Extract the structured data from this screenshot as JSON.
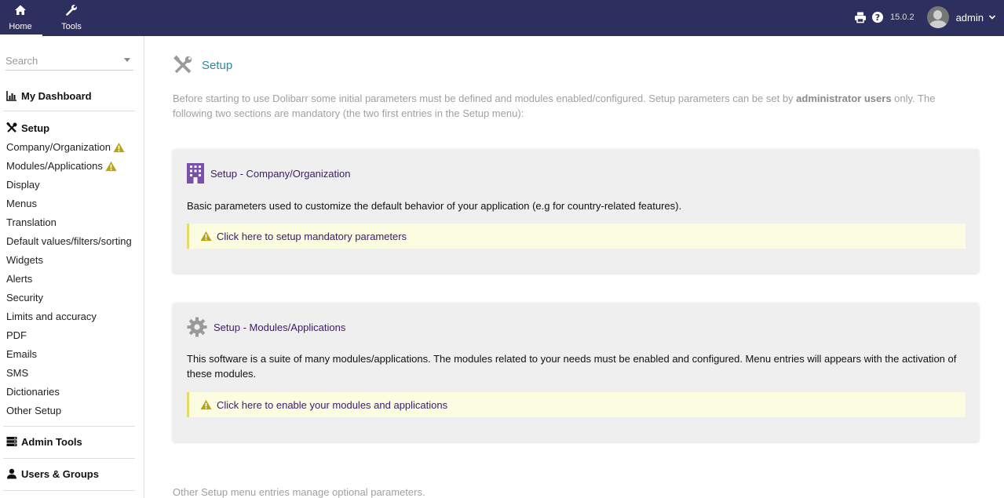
{
  "topbar": {
    "nav": [
      {
        "label": "Home",
        "icon": "home-icon"
      },
      {
        "label": "Tools",
        "icon": "wrench-icon"
      }
    ],
    "version": "15.0.2",
    "user": "admin"
  },
  "sidebar": {
    "search_placeholder": "Search",
    "dashboard": "My Dashboard",
    "setup": {
      "title": "Setup",
      "items": [
        {
          "label": "Company/Organization",
          "warning": true
        },
        {
          "label": "Modules/Applications",
          "warning": true
        },
        {
          "label": "Display"
        },
        {
          "label": "Menus"
        },
        {
          "label": "Translation"
        },
        {
          "label": "Default values/filters/sorting"
        },
        {
          "label": "Widgets"
        },
        {
          "label": "Alerts"
        },
        {
          "label": "Security"
        },
        {
          "label": "Limits and accuracy"
        },
        {
          "label": "PDF"
        },
        {
          "label": "Emails"
        },
        {
          "label": "SMS"
        },
        {
          "label": "Dictionaries"
        },
        {
          "label": "Other Setup"
        }
      ]
    },
    "admin_tools": "Admin Tools",
    "users_groups": "Users & Groups"
  },
  "main": {
    "title": "Setup",
    "intro_part1": "Before starting to use Dolibarr some initial parameters must be defined and modules enabled/configured. Setup parameters can be set by ",
    "intro_bold": "administrator users",
    "intro_part2": " only. The following two sections are mandatory (the two first entries in the Setup menu):",
    "card1": {
      "title": "Setup - Company/Organization",
      "text": "Basic parameters used to customize the default behavior of your application (e.g for country-related features).",
      "link": "Click here to setup mandatory parameters"
    },
    "card2": {
      "title": "Setup - Modules/Applications",
      "text": "This software is a suite of many modules/applications. The modules related to your needs must be enabled and configured. Menu entries will appears with the activation of these modules.",
      "link": "Click here to enable your modules and applications"
    },
    "footnote": "Other Setup menu entries manage optional parameters."
  },
  "colors": {
    "topbar": "#2d2f5e",
    "title": "#2a8a9e",
    "link": "#3b1a6e",
    "warning": "#b5a416",
    "notice_bg": "#fcfde0"
  }
}
